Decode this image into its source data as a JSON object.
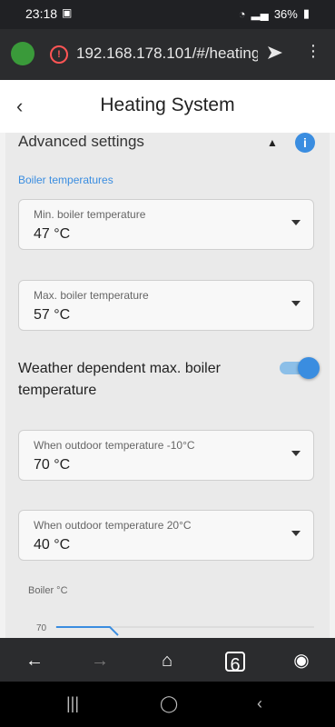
{
  "status": {
    "time": "23:18",
    "battery": "36%"
  },
  "browser": {
    "url": "192.168.178.101/#/heating"
  },
  "app": {
    "title": "Heating System"
  },
  "section": {
    "title": "Advanced settings",
    "subhead": "Boiler temperatures",
    "min_boiler": {
      "label": "Min. boiler temperature",
      "value": "47 °C"
    },
    "max_boiler": {
      "label": "Max. boiler temperature",
      "value": "57 °C"
    },
    "weather_dep": {
      "label": "Weather dependent max. boiler temperature",
      "on": true
    },
    "outdoor_minus10": {
      "label": "When outdoor temperature -10°C",
      "value": "70 °C"
    },
    "outdoor_20": {
      "label": "When outdoor temperature 20°C",
      "value": "40 °C"
    }
  },
  "chart_data": {
    "type": "line",
    "ylabel": "Boiler °C",
    "tick_labels": [
      "70"
    ],
    "series": [
      {
        "values": [
          70,
          70
        ]
      }
    ]
  },
  "navbar": {
    "tab_count": "6"
  }
}
